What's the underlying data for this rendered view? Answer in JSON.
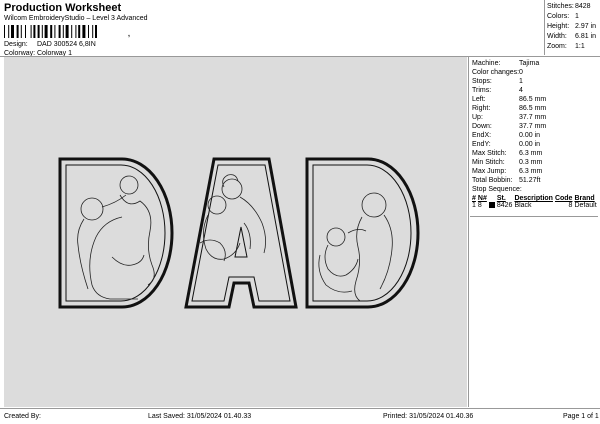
{
  "header": {
    "title": "Production Worksheet",
    "subtitle": "Wilcom EmbroideryStudio – Level 3 Advanced",
    "barcode_suffix": ",",
    "design_label": "Design:",
    "design_value": "DAD 300524 6,8IN",
    "colorway_label": "Colorway:",
    "colorway_value": "Colorway 1"
  },
  "summary": {
    "stitches_label": "Stitches:",
    "stitches_value": "8428",
    "colors_label": "Colors:",
    "colors_value": "1",
    "height_label": "Height:",
    "height_value": "2.97 in",
    "width_label": "Width:",
    "width_value": "6.81 in",
    "zoom_label": "Zoom:",
    "zoom_value": "1:1"
  },
  "design": {
    "letters": [
      "D",
      "A",
      "D"
    ],
    "fill_color": "#dcdcdc",
    "outline_color": "#111111"
  },
  "specs": [
    {
      "label": "Machine:",
      "value": "Tajima"
    },
    {
      "label": "Color changes:",
      "value": "0"
    },
    {
      "label": "Stops:",
      "value": "1"
    },
    {
      "label": "Trims:",
      "value": "4"
    },
    {
      "label": "Left:",
      "value": "86.5 mm"
    },
    {
      "label": "Right:",
      "value": "86.5 mm"
    },
    {
      "label": "Up:",
      "value": "37.7 mm"
    },
    {
      "label": "Down:",
      "value": "37.7 mm"
    },
    {
      "label": "EndX:",
      "value": "0.00 in"
    },
    {
      "label": "EndY:",
      "value": "0.00 in"
    },
    {
      "label": "Max Stitch:",
      "value": "6.3 mm"
    },
    {
      "label": "Min Stitch:",
      "value": "0.3 mm"
    },
    {
      "label": "Max Jump:",
      "value": "6.3 mm"
    },
    {
      "label": "Total Bobbin:",
      "value": "51.27ft"
    }
  ],
  "stop_sequence": {
    "title": "Stop Sequence:",
    "headers": [
      "#",
      "N#",
      "",
      "St.",
      "Description",
      "Code",
      "Brand"
    ],
    "rows": [
      {
        "num": "1",
        "n": "8",
        "stitches": "8426",
        "description": "Black",
        "code": "8",
        "brand": "Default",
        "color": "#000000"
      }
    ]
  },
  "footer": {
    "created_by": "Created By:",
    "last_saved": "Last Saved: 31/05/2024 01.40.33",
    "printed": "Printed: 31/05/2024 01.40.36",
    "page": "Page 1 of 1"
  }
}
